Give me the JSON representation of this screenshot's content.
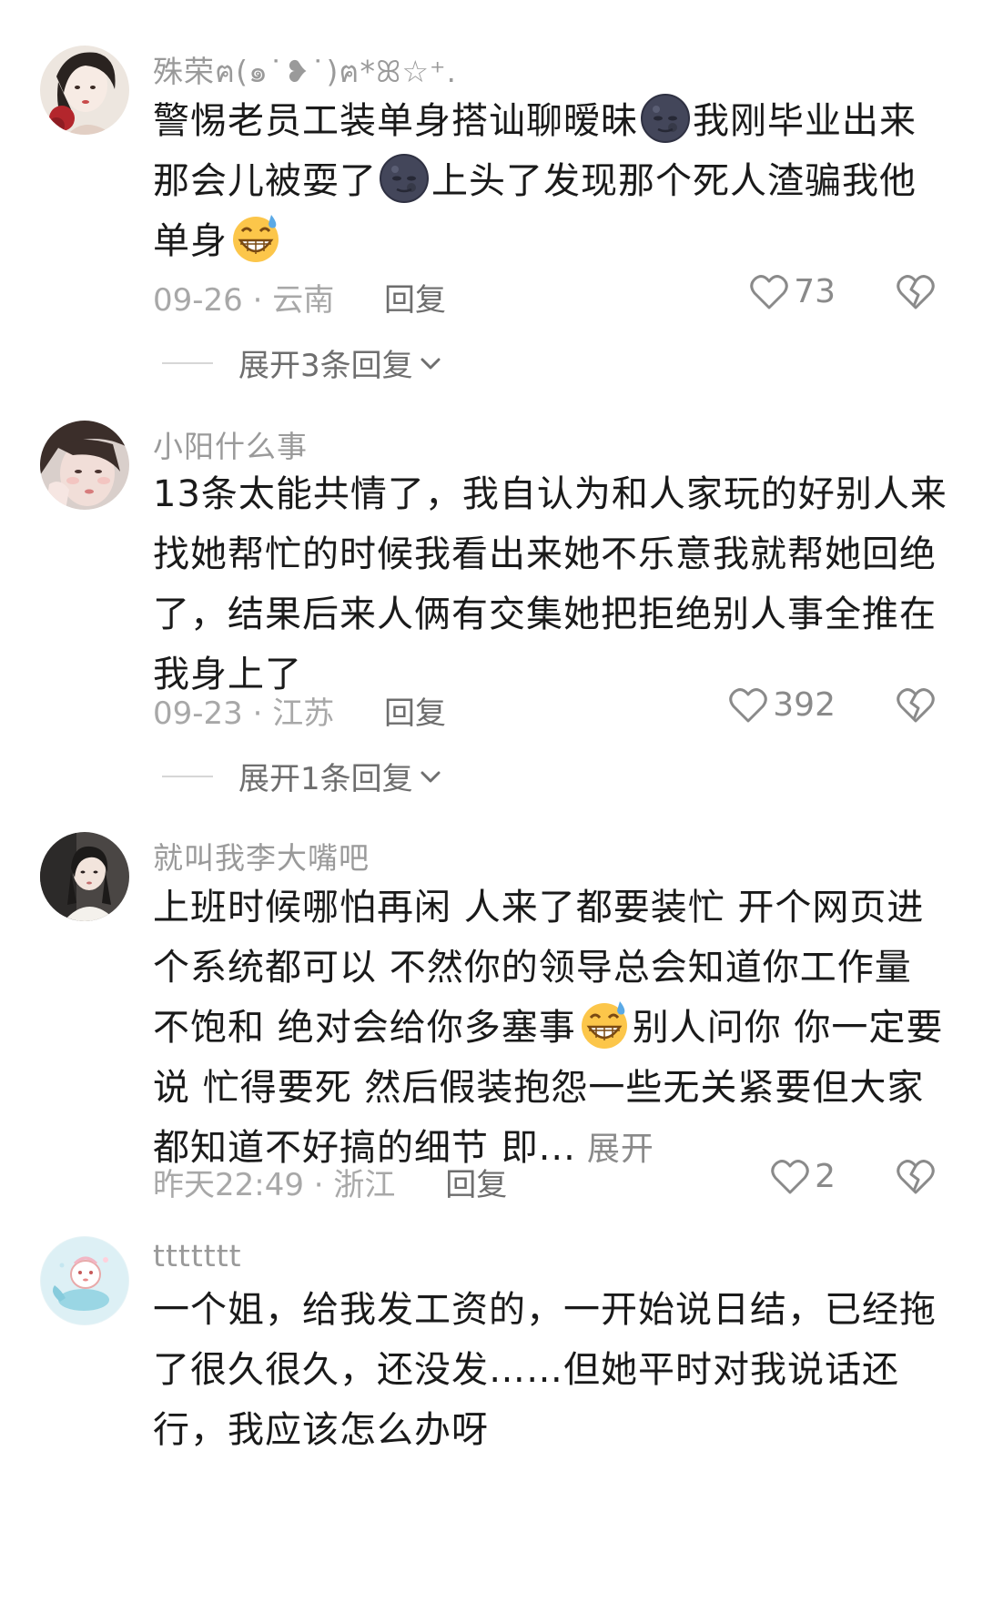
{
  "comments": [
    {
      "username": "殊荣ฅ(๑˙❥˙)ฅ*ꕤ☆⁺.",
      "lines": [
        [
          "警惕老员工装单身搭讪聊暧昧",
          "[moon]",
          "我刚毕业出来"
        ],
        [
          "那会儿被耍了",
          "[moon]",
          "上头了发现那个死人渣骗我他"
        ],
        [
          "单身",
          "[grin]"
        ]
      ],
      "date": "09-26",
      "location": "云南",
      "reply_label": "回复",
      "likes": "73",
      "expand_replies": "展开3条回复"
    },
    {
      "username": "小阳什么事",
      "lines": [
        [
          "13条太能共情了，我自认为和人家玩的好别人来"
        ],
        [
          "找她帮忙的时候我看出来她不乐意我就帮她回绝"
        ],
        [
          "了，结果后来人俩有交集她把拒绝别人事全推在"
        ],
        [
          "我身上了"
        ]
      ],
      "date": "09-23",
      "location": "江苏",
      "reply_label": "回复",
      "likes": "392",
      "expand_replies": "展开1条回复"
    },
    {
      "username": "就叫我李大嘴吧",
      "lines": [
        [
          "上班时候哪怕再闲 人来了都要装忙 开个网页进"
        ],
        [
          "个系统都可以 不然你的领导总会知道你工作量"
        ],
        [
          "不饱和 绝对会给你多塞事",
          "[grin]",
          "别人问你 你一定要"
        ],
        [
          "说 忙得要死 然后假装抱怨一些无关紧要但大家"
        ],
        [
          "都知道不好搞的细节 即..."
        ]
      ],
      "inline_expand": "展开",
      "date": "昨天22:49",
      "location": "浙江",
      "reply_label": "回复",
      "likes": "2"
    },
    {
      "username": "ttttttt",
      "lines": [
        [
          "一个姐，给我发工资的，一开始说日结，已经拖"
        ],
        [
          "了很久很久，还没发……但她平时对我说话还"
        ],
        [
          "行，我应该怎么办呀"
        ]
      ]
    }
  ],
  "meta_separator": "·",
  "icons": {
    "like": "heart-outline-icon",
    "dislike": "broken-heart-icon",
    "expand": "chevron-down-icon",
    "emoji_moon": "new-moon-face-emoji",
    "emoji_grin": "grinning-sweat-emoji"
  },
  "colors": {
    "text": "#1a1a1a",
    "meta": "#a8a8a8",
    "username": "#9a9a9a"
  }
}
